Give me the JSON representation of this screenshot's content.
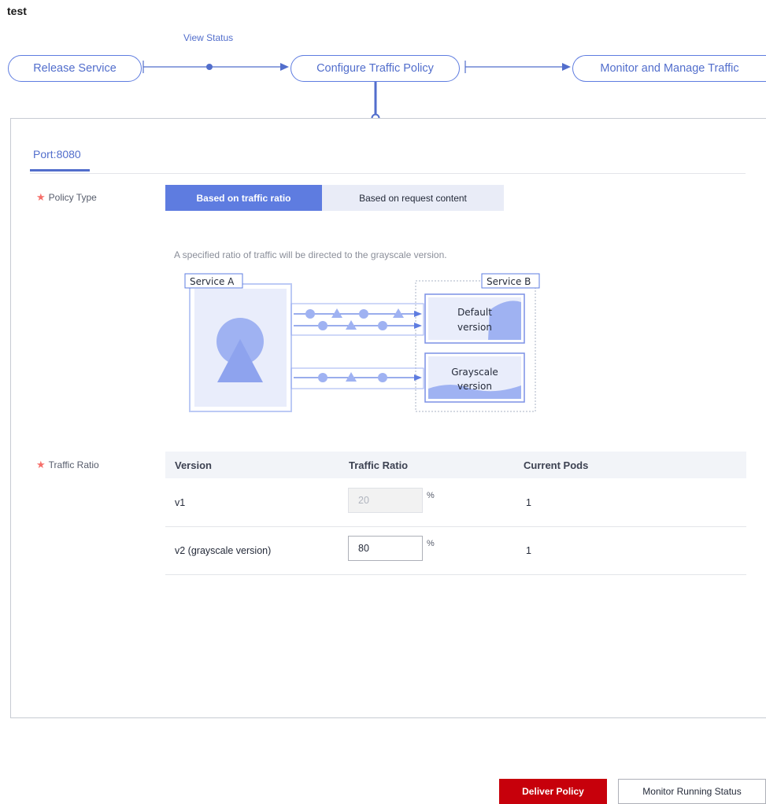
{
  "app": {
    "title": "test"
  },
  "flow": {
    "view_status_link": "View Status",
    "steps": [
      {
        "label": "Release Service"
      },
      {
        "label": "Configure Traffic Policy"
      },
      {
        "label": "Monitor and Manage Traffic"
      }
    ],
    "active_step_index": 1
  },
  "panel": {
    "port_tab": "Port:8080",
    "policy_type": {
      "label": "Policy Type",
      "options": [
        "Based on traffic ratio",
        "Based on request content"
      ],
      "selected": "Based on traffic ratio"
    },
    "description": "A specified ratio of traffic will be directed to the grayscale version.",
    "diagram": {
      "service_a": "Service A",
      "service_b": "Service B",
      "default_version": [
        "Default",
        "version"
      ],
      "grayscale_version": [
        "Grayscale",
        "version"
      ]
    },
    "traffic_ratio": {
      "label": "Traffic Ratio",
      "columns": [
        "Version",
        "Traffic Ratio",
        "Current Pods"
      ],
      "rows": [
        {
          "version": "v1",
          "ratio": "20",
          "unit": "%",
          "pods": "1",
          "editable": false
        },
        {
          "version": "v2 (grayscale version)",
          "ratio": "80",
          "unit": "%",
          "pods": "1",
          "editable": true
        }
      ]
    }
  },
  "actions": {
    "deliver_policy": "Deliver Policy",
    "monitor_running_status": "Monitor Running Status"
  },
  "colors": {
    "accent": "#5e7ce0",
    "link": "#526ecc",
    "primary_button": "#c7000b",
    "required_mark": "#f66f6a",
    "diagram_fill": "#9fb2f2"
  }
}
